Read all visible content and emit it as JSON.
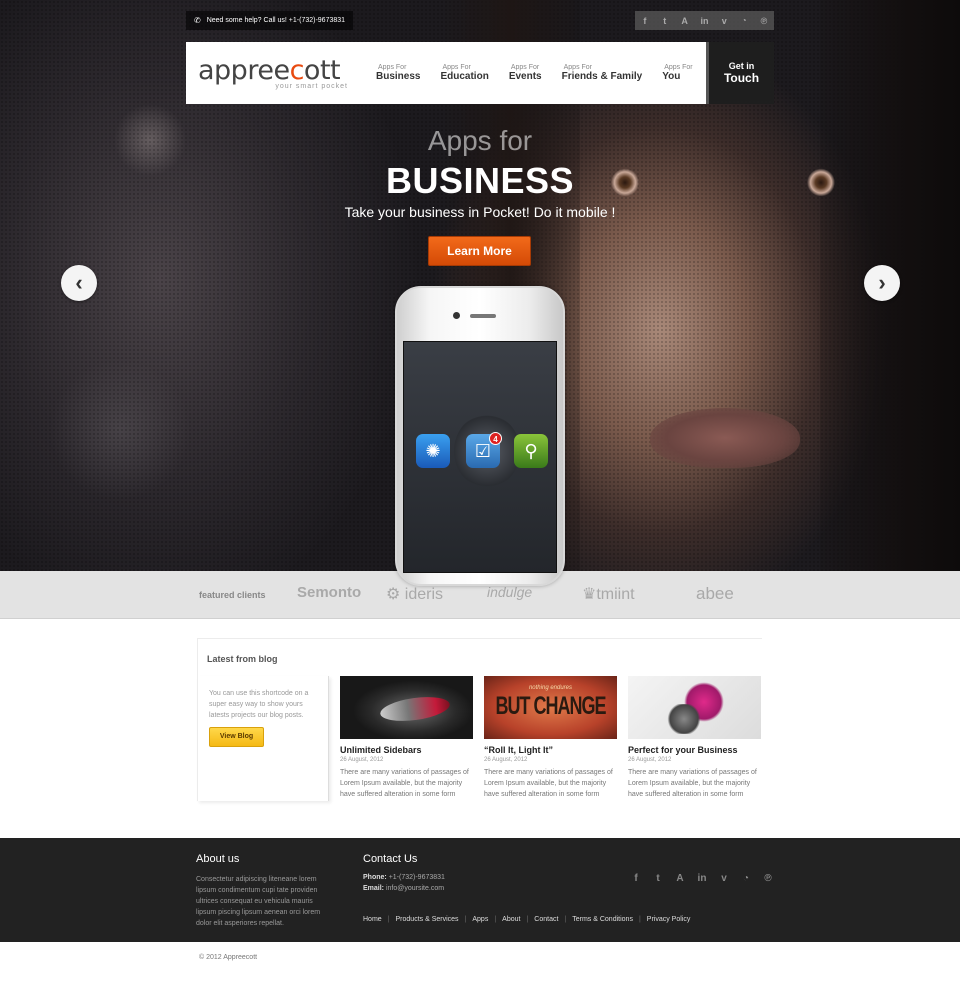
{
  "topbar": {
    "help_text": "Need some help? Call us! +1-(732)-9673831",
    "social": [
      "f",
      "t",
      "A",
      "in",
      "v",
      "rss",
      "p"
    ]
  },
  "brand": {
    "name_part1": "appree",
    "name_o": "c",
    "name_part2": "ott",
    "tagline": "your smart pocket"
  },
  "nav": {
    "items": [
      {
        "small": "Apps For",
        "big": "Business"
      },
      {
        "small": "Apps For",
        "big": "Education"
      },
      {
        "small": "Apps For",
        "big": "Events"
      },
      {
        "small": "Apps For",
        "big": "Friends & Family"
      },
      {
        "small": "Apps For",
        "big": "You"
      }
    ],
    "cta_small": "Get in",
    "cta_big": "Touch"
  },
  "hero": {
    "subtitle": "Apps for",
    "title": "BUSINESS",
    "tagline": "Take your business in Pocket! Do it mobile !",
    "button": "Learn More",
    "prev_arrow": "‹",
    "next_arrow": "›",
    "badge_count": "4"
  },
  "clients": {
    "label": "featured clients",
    "logos": [
      "Semonto",
      "ideris",
      "indulge",
      "tmiint",
      "abee"
    ]
  },
  "blog": {
    "header": "Latest from blog",
    "intro": "You can use this shortcode on a super easy way to show yours latests projects our blog posts.",
    "button": "View Blog",
    "posts": [
      {
        "title": "Unlimited Sidebars",
        "date": "26 August, 2012",
        "excerpt": "There are many variations of passages of Lorem Ipsum available, but the majority have suffered alteration in some form"
      },
      {
        "title": "“Roll It, Light It”",
        "date": "26 August, 2012",
        "excerpt": "There are many variations of passages of Lorem Ipsum available, but the majority have suffered alteration in some form",
        "thumb_text_top": "nothing endures",
        "thumb_text_main": "BUT CHANGE"
      },
      {
        "title": "Perfect for your Business",
        "date": "26 August, 2012",
        "excerpt": "There are many variations of passages of Lorem Ipsum available, but the majority have suffered alteration in some form"
      }
    ]
  },
  "footer": {
    "about_title": "About us",
    "about_text": "Consectetur adipiscing liteneane lorem lipsum condimentum cupi tate providen ultrices consequat eu vehicula mauris lipsum piscing lipsum aenean orci lorem dolor elit asperiores repellat.",
    "contact_title": "Contact Us",
    "phone_label": "Phone:",
    "phone": "+1-(732)-9673831",
    "email_label": "Email:",
    "email": "info@yoursite.com",
    "links": [
      "Home",
      "Products & Services",
      "Apps",
      "About",
      "Contact",
      "Terms & Conditions",
      "Privacy Policy"
    ],
    "copyright": "© 2012 Appreecott"
  },
  "colors": {
    "accent": "#e84a10",
    "cta_yellow": "#f5b914",
    "footer_bg": "#222222"
  }
}
